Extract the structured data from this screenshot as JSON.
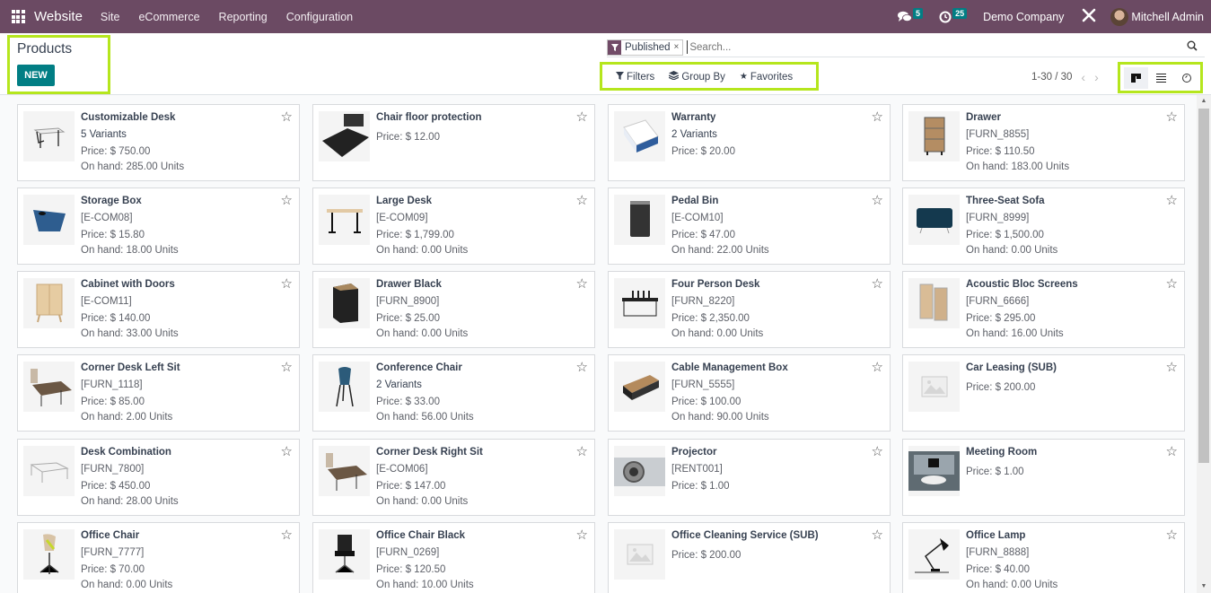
{
  "navbar": {
    "app_name": "Website",
    "menu": [
      "Site",
      "eCommerce",
      "Reporting",
      "Configuration"
    ],
    "messages_count": "5",
    "activities_count": "25",
    "company": "Demo Company",
    "user": "Mitchell Admin",
    "brand_color": "#714b67"
  },
  "control_panel": {
    "title": "Products",
    "new_label": "NEW",
    "facet_label": "Published",
    "facet_remove": "×",
    "search_placeholder": "Search...",
    "filters_label": "Filters",
    "group_by_label": "Group By",
    "favorites_label": "Favorites",
    "pager": "1-30 / 30",
    "pager_prev": "‹",
    "pager_next": "›",
    "views": [
      "kanban",
      "list",
      "activity"
    ],
    "active_view": "kanban",
    "accent_color": "#017e84",
    "highlight_color": "#b5e61d"
  },
  "products": [
    {
      "name": "Customizable Desk",
      "line2": "5 Variants",
      "line2_bold": true,
      "price": "Price: $ 750.00",
      "on_hand": "On hand: 285.00 Units",
      "image": "desk"
    },
    {
      "name": "Chair floor protection",
      "line2": "",
      "price": "Price: $ 12.00",
      "on_hand": "",
      "image": "mat"
    },
    {
      "name": "Warranty",
      "line2": "2 Variants",
      "line2_bold": true,
      "price": "Price: $ 20.00",
      "on_hand": "",
      "image": "box-blue"
    },
    {
      "name": "Drawer",
      "line2": "[FURN_8855]",
      "price": "Price: $ 110.50",
      "on_hand": "On hand: 183.00 Units",
      "image": "drawer-wood"
    },
    {
      "name": "Storage Box",
      "line2": "[E-COM08]",
      "price": "Price: $ 15.80",
      "on_hand": "On hand: 18.00 Units",
      "image": "basket"
    },
    {
      "name": "Large Desk",
      "line2": "[E-COM09]",
      "price": "Price: $ 1,799.00",
      "on_hand": "On hand: 0.00 Units",
      "image": "table"
    },
    {
      "name": "Pedal Bin",
      "line2": "[E-COM10]",
      "price": "Price: $ 47.00",
      "on_hand": "On hand: 22.00 Units",
      "image": "bin"
    },
    {
      "name": "Three-Seat Sofa",
      "line2": "[FURN_8999]",
      "price": "Price: $ 1,500.00",
      "on_hand": "On hand: 0.00 Units",
      "image": "sofa"
    },
    {
      "name": "Cabinet with Doors",
      "line2": "[E-COM11]",
      "price": "Price: $ 140.00",
      "on_hand": "On hand: 33.00 Units",
      "image": "cabinet"
    },
    {
      "name": "Drawer Black",
      "line2": "[FURN_8900]",
      "price": "Price: $ 25.00",
      "on_hand": "On hand: 0.00 Units",
      "image": "drawer-black"
    },
    {
      "name": "Four Person Desk",
      "line2": "[FURN_8220]",
      "price": "Price: $ 2,350.00",
      "on_hand": "On hand: 0.00 Units",
      "image": "desk4"
    },
    {
      "name": "Acoustic Bloc Screens",
      "line2": "[FURN_6666]",
      "price": "Price: $ 295.00",
      "on_hand": "On hand: 16.00 Units",
      "image": "screens"
    },
    {
      "name": "Corner Desk Left Sit",
      "line2": "[FURN_1118]",
      "price": "Price: $ 85.00",
      "on_hand": "On hand: 2.00 Units",
      "image": "corner"
    },
    {
      "name": "Conference Chair",
      "line2": "2 Variants",
      "line2_bold": true,
      "price": "Price: $ 33.00",
      "on_hand": "On hand: 56.00 Units",
      "image": "chair-blue"
    },
    {
      "name": "Cable Management Box",
      "line2": "[FURN_5555]",
      "price": "Price: $ 100.00",
      "on_hand": "On hand: 90.00 Units",
      "image": "cablebox"
    },
    {
      "name": "Car Leasing (SUB)",
      "line2": "",
      "price": "Price: $ 200.00",
      "on_hand": "",
      "image": "placeholder"
    },
    {
      "name": "Desk Combination",
      "line2": "[FURN_7800]",
      "price": "Price: $ 450.00",
      "on_hand": "On hand: 28.00 Units",
      "image": "deskcombo"
    },
    {
      "name": "Corner Desk Right Sit",
      "line2": "[E-COM06]",
      "price": "Price: $ 147.00",
      "on_hand": "On hand: 0.00 Units",
      "image": "corner"
    },
    {
      "name": "Projector",
      "line2": "[RENT001]",
      "price": "Price: $ 1.00",
      "on_hand": "",
      "image": "projector"
    },
    {
      "name": "Meeting Room",
      "line2": "",
      "price": "Price: $ 1.00",
      "on_hand": "",
      "image": "room"
    },
    {
      "name": "Office Chair",
      "line2": "[FURN_7777]",
      "price": "Price: $ 70.00",
      "on_hand": "On hand: 0.00 Units",
      "image": "chair-yellow"
    },
    {
      "name": "Office Chair Black",
      "line2": "[FURN_0269]",
      "price": "Price: $ 120.50",
      "on_hand": "On hand: 10.00 Units",
      "image": "chair-black"
    },
    {
      "name": "Office Cleaning Service (SUB)",
      "line2": "",
      "price": "Price: $ 200.00",
      "on_hand": "",
      "image": "placeholder"
    },
    {
      "name": "Office Lamp",
      "line2": "[FURN_8888]",
      "price": "Price: $ 40.00",
      "on_hand": "On hand: 0.00 Units",
      "image": "lamp"
    }
  ]
}
